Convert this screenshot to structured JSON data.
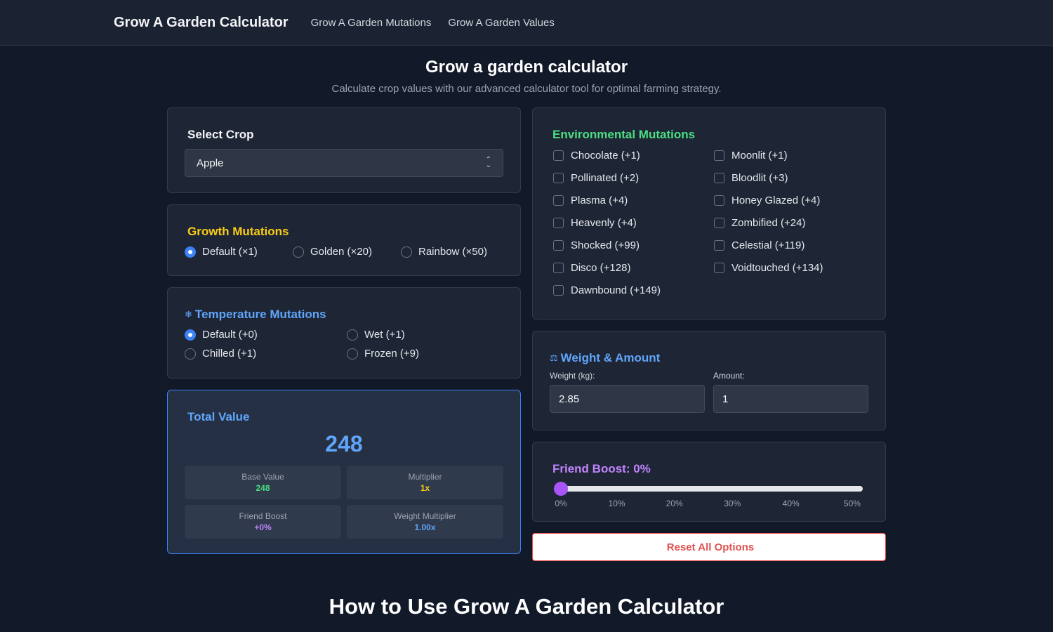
{
  "nav": {
    "brand_icon": "",
    "brand": "Grow A Garden Calculator",
    "links": [
      "Grow A Garden Mutations",
      "Grow A Garden Values"
    ]
  },
  "page": {
    "title": "Grow a garden calculator",
    "subtitle": "Calculate crop values with our advanced calculator tool for optimal farming strategy."
  },
  "crop": {
    "icon": "",
    "title": "Select Crop",
    "selected": "Apple"
  },
  "growth": {
    "icon": "",
    "title": "Growth Mutations",
    "options": [
      "Default (×1)",
      "Golden (×20)",
      "Rainbow (×50)"
    ],
    "selected_index": 0
  },
  "temperature": {
    "icon": "❄",
    "title": "Temperature Mutations",
    "options": [
      "Default (+0)",
      "Wet (+1)",
      "Chilled (+1)",
      "Frozen (+9)"
    ],
    "selected_index": 0
  },
  "total": {
    "icon": "",
    "title": "Total Value",
    "amount": " 248",
    "base_label": "Base Value",
    "base_value": "248",
    "multiplier_label": "Multiplier",
    "multiplier_value": "1x",
    "friend_label": "Friend Boost",
    "friend_value": "+0%",
    "weight_label": "Weight Multiplier",
    "weight_value": "1.00x"
  },
  "environmental": {
    "icon": "",
    "title": "Environmental Mutations",
    "options": [
      "Chocolate (+1)",
      "Moonlit (+1)",
      "Pollinated (+2)",
      "Bloodlit (+3)",
      "Plasma (+4)",
      "Honey Glazed (+4)",
      "Heavenly (+4)",
      "Zombified (+24)",
      "Shocked (+99)",
      "Celestial (+119)",
      "Disco (+128)",
      "Voidtouched (+134)",
      "Dawnbound (+149)"
    ]
  },
  "weight": {
    "icon": "⚖",
    "title": "Weight & Amount",
    "weight_label": "Weight (kg):",
    "weight_value": "2.85",
    "amount_label": "Amount:",
    "amount_value": "1"
  },
  "friend": {
    "icon": "",
    "title": "Friend Boost: 0%",
    "value_percent": 0,
    "ticks": [
      "0%",
      "10%",
      "20%",
      "30%",
      "40%",
      "50%"
    ]
  },
  "reset": {
    "icon": "",
    "label": "Reset All Options"
  },
  "bottom": {
    "heading": "How to Use Grow A Garden Calculator"
  },
  "colors": {
    "background": "#121a2a",
    "accent_blue": "#3b82f6",
    "growth_yellow": "#facc15",
    "env_green": "#4ade80",
    "friend_purple": "#a855f7",
    "reset_red": "#ef4444"
  }
}
